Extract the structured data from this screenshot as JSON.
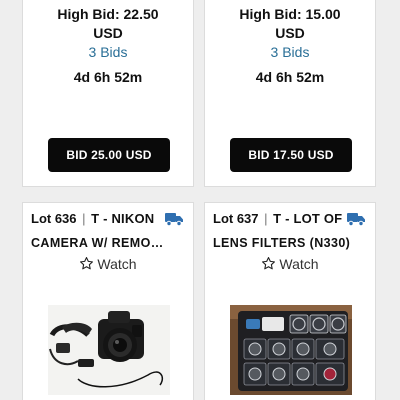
{
  "cards_top": [
    {
      "high_bid_label": "High Bid: 22.50",
      "currency": "USD",
      "bids": "3 Bids",
      "time_left": "4d 6h 52m",
      "bid_button": "BID 25.00 USD"
    },
    {
      "high_bid_label": "High Bid: 15.00",
      "currency": "USD",
      "bids": "3 Bids",
      "time_left": "4d 6h 52m",
      "bid_button": "BID 17.50 USD"
    }
  ],
  "cards_bottom": [
    {
      "lot_number": "Lot 636",
      "separator": "|",
      "title_line1": "T - NIKON",
      "title_line2": "CAMERA W/ REMO…",
      "watch_label": "Watch",
      "shipping_icon": "truck-icon",
      "photo_subject": "camera-photo"
    },
    {
      "lot_number": "Lot 637",
      "separator": "|",
      "title_line1": "T - LOT OF",
      "title_line2": "LENS FILTERS (N330)",
      "watch_label": "Watch",
      "shipping_icon": "truck-icon",
      "photo_subject": "lens-filters-photo"
    }
  ],
  "colors": {
    "link": "#2a6f97",
    "button_bg": "#0a0a0a",
    "truck": "#2f6fb0"
  }
}
